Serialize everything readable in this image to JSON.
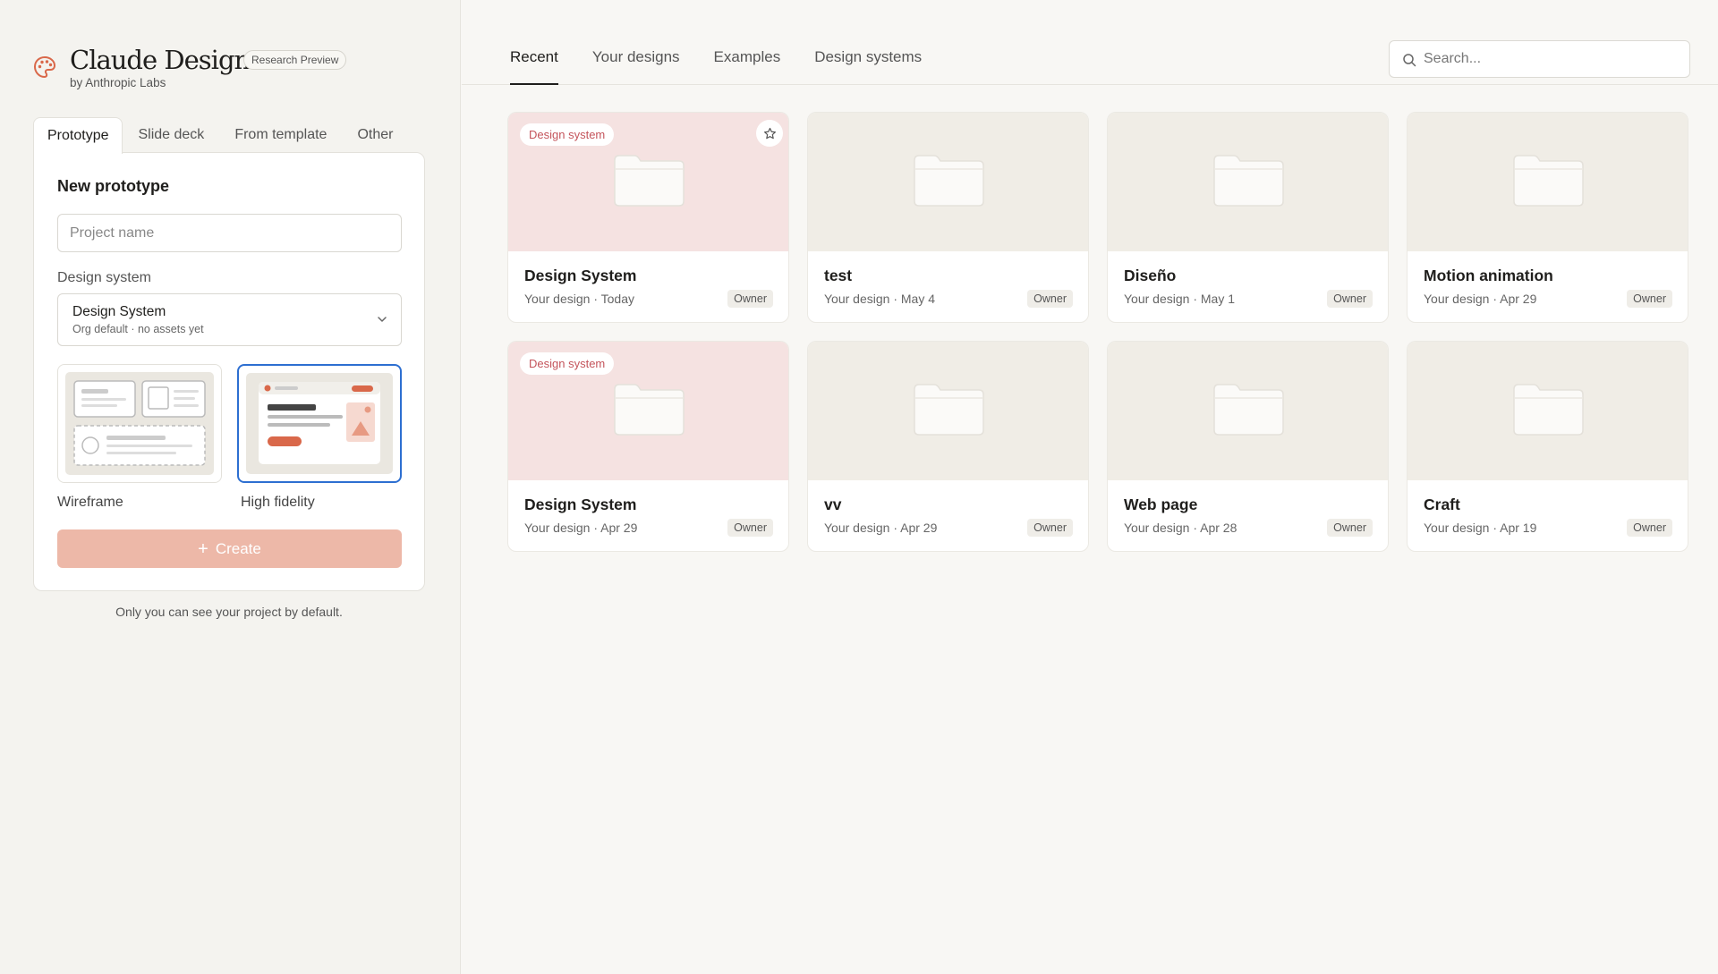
{
  "brand": {
    "title": "Claude Design",
    "badge": "Research Preview",
    "subtitle": "by Anthropic Labs"
  },
  "left_tabs": [
    {
      "label": "Prototype",
      "active": true
    },
    {
      "label": "Slide deck",
      "active": false
    },
    {
      "label": "From template",
      "active": false
    },
    {
      "label": "Other",
      "active": false
    }
  ],
  "form": {
    "title": "New prototype",
    "project_placeholder": "Project name",
    "project_value": "",
    "design_system_label": "Design System",
    "design_system_section_label": "Design system",
    "design_system_value": "Design System",
    "design_system_sub": "Org default · no assets yet",
    "fidelity": {
      "wireframe_label": "Wireframe",
      "high_fidelity_label": "High fidelity",
      "selected": "High fidelity"
    },
    "create_label": "Create",
    "privacy_note": "Only you can see your project by default."
  },
  "main_tabs": [
    {
      "label": "Recent",
      "active": true
    },
    {
      "label": "Your designs",
      "active": false
    },
    {
      "label": "Examples",
      "active": false
    },
    {
      "label": "Design systems",
      "active": false
    }
  ],
  "search": {
    "placeholder": "Search...",
    "value": ""
  },
  "projects": [
    {
      "title": "Design System",
      "meta": "Your design · Today",
      "role": "Owner",
      "tag": "Design system",
      "starrable": true
    },
    {
      "title": "test",
      "meta": "Your design · May 4",
      "role": "Owner",
      "tag": "",
      "starrable": false
    },
    {
      "title": "Diseño",
      "meta": "Your design · May 1",
      "role": "Owner",
      "tag": "",
      "starrable": false
    },
    {
      "title": "Motion animation",
      "meta": "Your design · Apr 29",
      "role": "Owner",
      "tag": "",
      "starrable": false
    },
    {
      "title": "Design System",
      "meta": "Your design · Apr 29",
      "role": "Owner",
      "tag": "Design system",
      "starrable": false
    },
    {
      "title": "vv",
      "meta": "Your design · Apr 29",
      "role": "Owner",
      "tag": "",
      "starrable": false
    },
    {
      "title": "Web page",
      "meta": "Your design · Apr 28",
      "role": "Owner",
      "tag": "",
      "starrable": false
    },
    {
      "title": "Craft",
      "meta": "Your design · Apr 19",
      "role": "Owner",
      "tag": "",
      "starrable": false
    }
  ],
  "icons": {
    "brand": "palette-icon",
    "select": "chevron-down-icon",
    "create": "plus-icon",
    "search": "search-icon",
    "favorite": "star-icon",
    "thumbnail": "folder-icon"
  },
  "colors": {
    "accent": "#d9684a",
    "create_button": "#edb8a8",
    "selected_border": "#2d6fd1",
    "design_system_thumb": "#f5e2e1",
    "design_system_tag_text": "#c4545b",
    "default_thumb": "#f0ede6"
  }
}
